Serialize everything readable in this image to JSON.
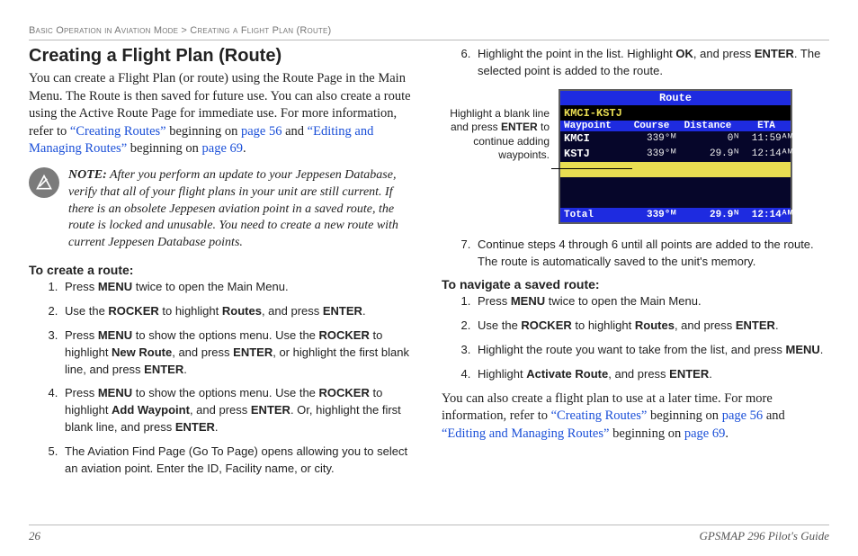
{
  "breadcrumb": {
    "section": "Basic Operation in Aviation Mode",
    "sep": " > ",
    "page": "Creating a Flight Plan (Route)"
  },
  "left": {
    "heading": "Creating a Flight Plan (Route)",
    "intro_parts": {
      "p1": "You can create a Flight Plan (or route) using the Route Page in the Main Menu. The Route is then saved for future use. You can also create a route using the Active Route Page for immediate use. For more information, refer to ",
      "link1": "“Creating Routes”",
      "p2": " beginning on ",
      "link2": "page 56",
      "p3": " and ",
      "link3": "“Editing and Managing Routes”",
      "p4": " beginning on ",
      "link4": "page 69",
      "p5": "."
    },
    "note_label": "NOTE:",
    "note_body": " After you perform an update to your Jeppesen Database, verify that all of your flight plans in your unit are still current. If there is an obsolete Jeppesen aviation point in a saved route, the route is locked and unusable. You need to create a new route with current Jeppesen Database points.",
    "subhead": "To create a route:",
    "steps": [
      {
        "a": "Press ",
        "b": "MENU",
        "c": " twice to open the Main Menu."
      },
      {
        "a": "Use the ",
        "b": "ROCKER",
        "c": " to highlight ",
        "d": "Routes",
        "e": ", and press ",
        "f": "ENTER",
        "g": "."
      },
      {
        "a": "Press ",
        "b": "MENU",
        "c": " to show the options menu. Use the ",
        "d": "ROCKER",
        "e": " to highlight ",
        "f": "New Route",
        "g": ", and press ",
        "h": "ENTER",
        "i": ", or highlight the first blank line, and press ",
        "j": "ENTER",
        "k": "."
      },
      {
        "a": "Press ",
        "b": "MENU",
        "c": " to show the options menu. Use the ",
        "d": "ROCKER",
        "e": " to highlight ",
        "f": "Add Waypoint",
        "g": ", and press ",
        "h": "ENTER",
        "i": ". Or, highlight the first blank line, and press ",
        "j": "ENTER",
        "k": "."
      },
      {
        "a": "The Aviation Find Page (Go To Page) opens allowing you to select an aviation point. Enter the ID, Facility name, or city."
      }
    ]
  },
  "right": {
    "step6": {
      "a": "Highlight the point in the list. Highlight ",
      "b": "OK",
      "c": ", and press ",
      "d": "ENTER",
      "e": ". The selected point is added to the route."
    },
    "callout": {
      "a": "Highlight a blank line and press ",
      "b": "ENTER",
      "c": " to continue adding waypoints."
    },
    "device": {
      "title": "Route",
      "subtitle": "KMCI-KSTJ",
      "headers": [
        "Waypoint",
        "Course",
        "Distance",
        "ETA"
      ],
      "rows": [
        {
          "wp": "KMCI",
          "course": "339°ᴹ",
          "dist": "0ᴺ",
          "eta": "11:59ᴬᴹ"
        },
        {
          "wp": "KSTJ",
          "course": "339°ᴹ",
          "dist": "29.9ᴺ",
          "eta": "12:14ᴬᴹ"
        }
      ],
      "total_label": "Total",
      "total": {
        "course": "339°ᴹ",
        "dist": "29.9ᴺ",
        "eta": "12:14ᴬᴹ"
      }
    },
    "step7": {
      "a": "Continue steps 4 through 6 until all points are added to the route. The route is automatically saved to the unit's memory."
    },
    "subhead": "To navigate a saved route:",
    "nav_steps": [
      {
        "a": "Press ",
        "b": "MENU",
        "c": " twice to open the Main Menu."
      },
      {
        "a": "Use the ",
        "b": "ROCKER",
        "c": " to highlight ",
        "d": "Routes",
        "e": ", and press ",
        "f": "ENTER",
        "g": "."
      },
      {
        "a": "Highlight the route you want to take from the list, and press ",
        "b": "MENU",
        "c": "."
      },
      {
        "a": "Highlight ",
        "b": "Activate Route",
        "c": ", and press ",
        "d": "ENTER",
        "e": "."
      }
    ],
    "closing": {
      "p1": "You can also create a flight plan to use at a later time. For more information, refer to ",
      "link1": "“Creating Routes”",
      "p2": " beginning on ",
      "link2": "page 56",
      "p3": " and ",
      "link3": "“Editing and Managing Routes”",
      "p4": " beginning on ",
      "link4": "page 69",
      "p5": "."
    }
  },
  "footer": {
    "page": "26",
    "guide": "GPSMAP 296 Pilot's Guide"
  }
}
